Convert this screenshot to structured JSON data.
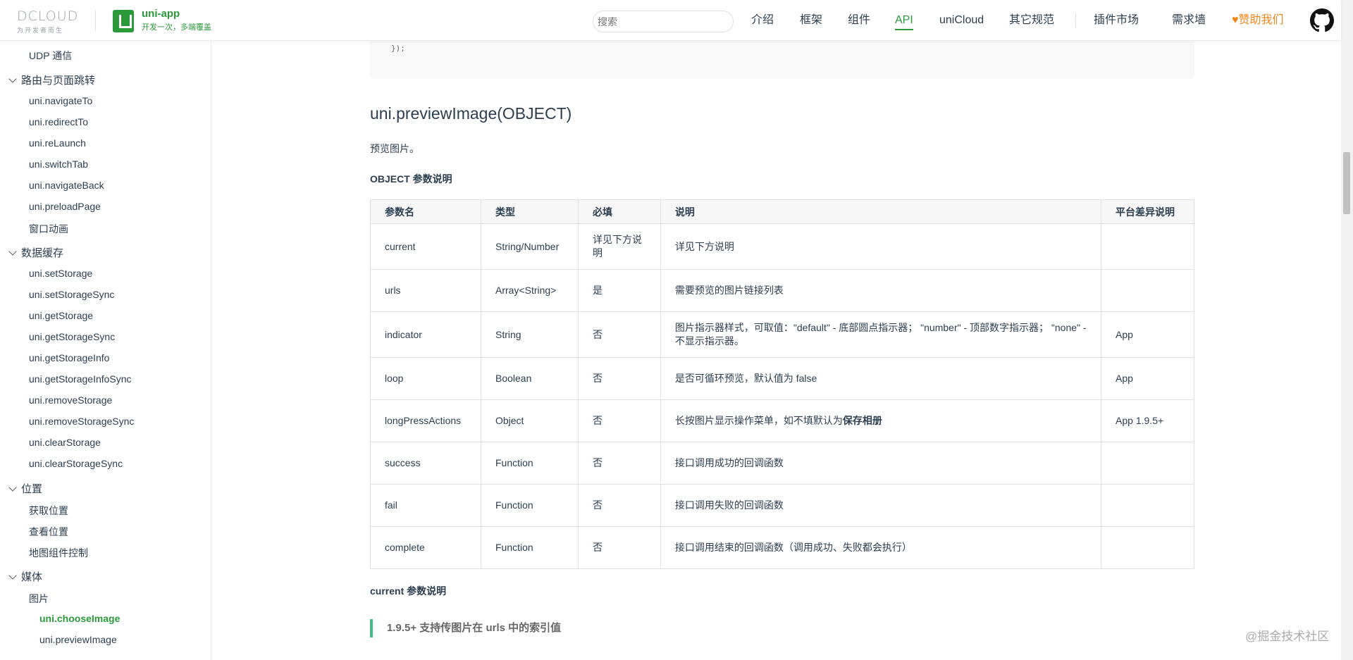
{
  "header": {
    "dcloud_brand": "DCLOUD",
    "dcloud_slogan": "为开发者而生",
    "uni_name": "uni-app",
    "uni_tagline": "开发一次，多端覆盖",
    "search_placeholder": "搜索",
    "nav": [
      {
        "label": "介绍"
      },
      {
        "label": "框架"
      },
      {
        "label": "组件"
      },
      {
        "label": "API"
      },
      {
        "label": "uniCloud"
      },
      {
        "label": "其它规范"
      },
      {
        "label": "插件市场"
      },
      {
        "label": "需求墙"
      },
      {
        "label": "赞助我们"
      }
    ],
    "sponsor_heart": "♥"
  },
  "sidebar": {
    "udp": "UDP 通信",
    "group_route": "路由与页面跳转",
    "route_items": [
      "uni.navigateTo",
      "uni.redirectTo",
      "uni.reLaunch",
      "uni.switchTab",
      "uni.navigateBack",
      "uni.preloadPage",
      "窗口动画"
    ],
    "group_storage": "数据缓存",
    "storage_items": [
      "uni.setStorage",
      "uni.setStorageSync",
      "uni.getStorage",
      "uni.getStorageSync",
      "uni.getStorageInfo",
      "uni.getStorageInfoSync",
      "uni.removeStorage",
      "uni.removeStorageSync",
      "uni.clearStorage",
      "uni.clearStorageSync"
    ],
    "group_location": "位置",
    "location_items": [
      "获取位置",
      "查看位置",
      "地图组件控制"
    ],
    "group_media": "媒体",
    "media_sub": "图片",
    "image_items": [
      "uni.chooseImage",
      "uni.previewImage"
    ]
  },
  "content": {
    "code_tail": "});",
    "title": "uni.previewImage(OBJECT)",
    "desc": "预览图片。",
    "object_heading": "OBJECT 参数说明",
    "table": {
      "headers": [
        "参数名",
        "类型",
        "必填",
        "说明",
        "平台差异说明"
      ],
      "rows": [
        {
          "name": "current",
          "type": "String/Number",
          "required": "详见下方说明",
          "desc": "详见下方说明",
          "platform": ""
        },
        {
          "name": "urls",
          "type": "Array<String>",
          "required": "是",
          "desc": "需要预览的图片链接列表",
          "platform": ""
        },
        {
          "name": "indicator",
          "type": "String",
          "required": "否",
          "desc": "图片指示器样式，可取值：\"default\" - 底部圆点指示器； \"number\" - 顶部数字指示器； \"none\" - 不显示指示器。",
          "platform": "App"
        },
        {
          "name": "loop",
          "type": "Boolean",
          "required": "否",
          "desc": "是否可循环预览，默认值为 false",
          "platform": "App"
        },
        {
          "name": "longPressActions",
          "type": "Object",
          "required": "否",
          "desc_prefix": "长按图片显示操作菜单，如不填默认为",
          "desc_bold": "保存相册",
          "platform": "App 1.9.5+"
        },
        {
          "name": "success",
          "type": "Function",
          "required": "否",
          "desc": "接口调用成功的回调函数",
          "platform": ""
        },
        {
          "name": "fail",
          "type": "Function",
          "required": "否",
          "desc": "接口调用失败的回调函数",
          "platform": ""
        },
        {
          "name": "complete",
          "type": "Function",
          "required": "否",
          "desc": "接口调用结束的回调函数（调用成功、失败都会执行）",
          "platform": ""
        }
      ]
    },
    "current_heading": "current 参数说明",
    "tip": "1.9.5+ 支持传图片在 urls 中的索引值"
  },
  "watermark": "@掘金技术社区",
  "colors": {
    "brand_green": "#2b9939",
    "sponsor_orange": "#f08519",
    "tip_border": "#42b983"
  }
}
